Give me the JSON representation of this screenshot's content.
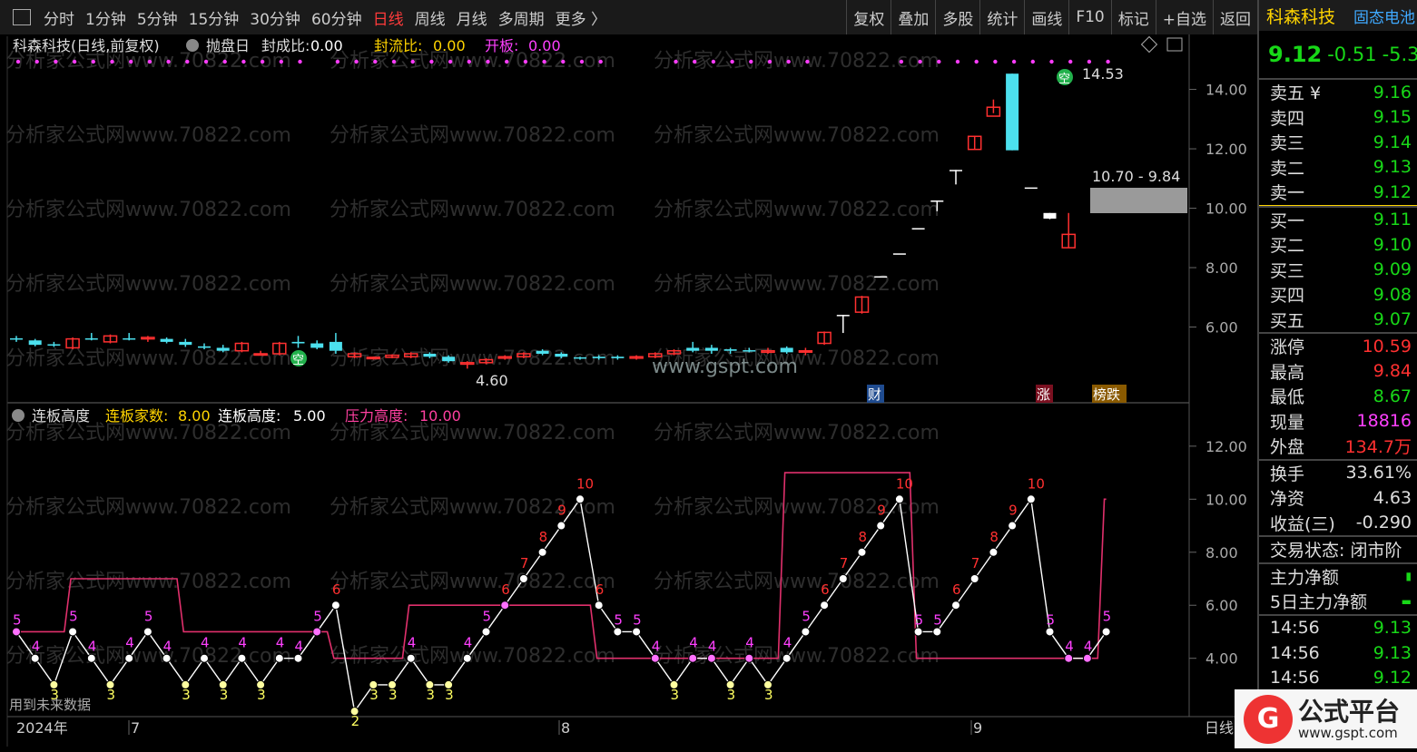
{
  "toolbar": {
    "periods": [
      "分时",
      "1分钟",
      "5分钟",
      "15分钟",
      "30分钟",
      "60分钟",
      "日线",
      "周线",
      "月线",
      "多周期",
      "更多 〉"
    ],
    "active": "日线",
    "actions": [
      "复权",
      "叠加",
      "多股",
      "统计",
      "画线",
      "F10",
      "标记",
      "+自选",
      "返回"
    ]
  },
  "chart_title": "科森科技(日线,前复权)",
  "main_labels": {
    "flag": "抛盘日",
    "fcb_label": "封成比:",
    "fcb_value": "0.00",
    "flb_label": "封流比:",
    "flb_value": "0.00",
    "kb_label": "开板:",
    "kb_value": "0.00"
  },
  "annotations": {
    "high": "14.53",
    "low": "4.60",
    "gap": "10.70 - 9.84",
    "kong": "空",
    "markers": [
      "财",
      "涨",
      "榜跌"
    ],
    "watermark": "www.gspt.com",
    "bg_watermark": "分析家公式网www.70822.com"
  },
  "price_axis": [
    "14.00",
    "12.00",
    "10.00",
    "8.00",
    "6.00"
  ],
  "sub_title": "连板高度",
  "sub_labels": {
    "lbjs_label": "连板家数:",
    "lbjs_value": "8.00",
    "lbgd_label": "连板高度:",
    "lbgd_value": "5.00",
    "ylgd_label": "压力高度:",
    "ylgd_value": "10.00"
  },
  "sub_axis": [
    "12.00",
    "10.00",
    "8.00",
    "6.00",
    "4.00"
  ],
  "future_note": "用到未来数据",
  "time_axis": [
    "2024年",
    "7",
    "8",
    "9"
  ],
  "period_label": "日线",
  "chart_data": {
    "type": "line",
    "candles": [
      [
        5.62,
        5.7,
        5.5,
        5.6,
        "c"
      ],
      [
        5.55,
        5.6,
        5.35,
        5.4,
        "c"
      ],
      [
        5.42,
        5.5,
        5.33,
        5.4,
        "c"
      ],
      [
        5.3,
        5.65,
        5.25,
        5.6,
        "r"
      ],
      [
        5.62,
        5.8,
        5.55,
        5.6,
        "c"
      ],
      [
        5.5,
        5.75,
        5.45,
        5.7,
        "r"
      ],
      [
        5.62,
        5.8,
        5.55,
        5.6,
        "c"
      ],
      [
        5.6,
        5.7,
        5.5,
        5.65,
        "r"
      ],
      [
        5.6,
        5.65,
        5.45,
        5.5,
        "c"
      ],
      [
        5.5,
        5.6,
        5.33,
        5.4,
        "c"
      ],
      [
        5.35,
        5.45,
        5.25,
        5.3,
        "c"
      ],
      [
        5.3,
        5.4,
        5.15,
        5.2,
        "c"
      ],
      [
        5.2,
        5.5,
        5.15,
        5.45,
        "r"
      ],
      [
        5.1,
        5.2,
        5.05,
        5.1,
        "r"
      ],
      [
        5.1,
        5.5,
        5.05,
        5.45,
        "r"
      ],
      [
        5.45,
        5.7,
        5.3,
        5.5,
        "c"
      ],
      [
        5.45,
        5.55,
        5.25,
        5.3,
        "c"
      ],
      [
        5.5,
        5.8,
        5.1,
        5.2,
        "c"
      ],
      [
        5.1,
        5.15,
        4.95,
        5.0,
        "r"
      ],
      [
        4.96,
        5.0,
        4.9,
        4.98,
        "r"
      ],
      [
        4.98,
        5.08,
        4.95,
        5.05,
        "r"
      ],
      [
        5.0,
        5.15,
        4.95,
        5.1,
        "r"
      ],
      [
        5.1,
        5.15,
        4.95,
        5.0,
        "c"
      ],
      [
        5.0,
        5.05,
        4.8,
        4.85,
        "c"
      ],
      [
        4.75,
        4.85,
        4.6,
        4.8,
        "r"
      ],
      [
        4.8,
        4.95,
        4.75,
        4.9,
        "r"
      ],
      [
        4.95,
        5.05,
        4.9,
        5.0,
        "r"
      ],
      [
        5.0,
        5.15,
        4.95,
        5.1,
        "r"
      ],
      [
        5.1,
        5.25,
        5.05,
        5.2,
        "c"
      ],
      [
        5.1,
        5.15,
        4.95,
        5.0,
        "c"
      ],
      [
        4.95,
        5.0,
        4.9,
        4.98,
        "c"
      ],
      [
        5.0,
        5.05,
        4.9,
        4.95,
        "c"
      ],
      [
        4.95,
        5.05,
        4.9,
        5.0,
        "c"
      ],
      [
        4.95,
        5.05,
        4.9,
        5.0,
        "r"
      ],
      [
        5.0,
        5.15,
        4.95,
        5.1,
        "r"
      ],
      [
        5.1,
        5.25,
        5.05,
        5.2,
        "r"
      ],
      [
        5.2,
        5.5,
        5.15,
        5.3,
        "c"
      ],
      [
        5.3,
        5.4,
        5.1,
        5.2,
        "c"
      ],
      [
        5.2,
        5.3,
        5.1,
        5.25,
        "c"
      ],
      [
        5.2,
        5.3,
        5.15,
        5.22,
        "c"
      ],
      [
        5.15,
        5.3,
        5.1,
        5.2,
        "r"
      ],
      [
        5.15,
        5.35,
        5.1,
        5.3,
        "c"
      ],
      [
        5.2,
        5.3,
        5.05,
        5.2,
        "r"
      ],
      [
        5.45,
        5.85,
        5.4,
        5.82,
        "r"
      ],
      [
        6.41,
        6.41,
        5.8,
        6.41,
        "w"
      ],
      [
        6.5,
        7.05,
        6.45,
        7.01,
        "r"
      ],
      [
        7.71,
        7.71,
        7.71,
        7.71,
        "w"
      ],
      [
        8.48,
        8.48,
        8.48,
        8.48,
        "w"
      ],
      [
        9.33,
        9.33,
        9.33,
        9.33,
        "w"
      ],
      [
        10.26,
        10.26,
        9.9,
        10.26,
        "w"
      ],
      [
        11.29,
        11.29,
        10.8,
        11.29,
        "w"
      ],
      [
        11.98,
        12.42,
        11.98,
        12.42,
        "r"
      ],
      [
        13.1,
        13.66,
        13.2,
        13.4,
        "r"
      ],
      [
        14.53,
        14.53,
        11.95,
        11.95,
        "c"
      ],
      [
        10.7,
        10.7,
        10.7,
        10.7,
        "w"
      ],
      [
        9.84,
        9.84,
        9.63,
        9.65,
        "w"
      ],
      [
        8.67,
        9.84,
        8.67,
        9.12,
        "r"
      ]
    ],
    "lbjs_series": [
      5,
      4,
      3,
      5,
      4,
      3,
      4,
      5,
      4,
      3,
      4,
      3,
      4,
      3,
      4,
      4,
      5,
      6,
      2,
      3,
      3,
      4,
      3,
      3,
      4,
      5,
      6,
      7,
      8,
      9,
      10,
      6,
      5,
      5,
      4,
      3,
      4,
      4,
      3,
      4,
      3,
      4,
      5,
      6,
      7,
      8,
      9,
      10,
      5,
      5,
      6,
      7,
      8,
      9,
      10,
      5,
      4,
      4,
      5
    ],
    "yl_series": [
      5,
      5,
      5,
      7,
      7,
      7,
      7,
      7,
      7,
      5,
      5,
      5,
      5,
      5,
      5,
      5,
      5,
      4,
      4,
      4,
      4,
      6,
      6,
      6,
      6,
      6,
      6,
      6,
      6,
      6,
      6,
      4,
      4,
      4,
      4,
      4,
      4,
      4,
      4,
      4,
      4,
      11,
      11,
      11,
      11,
      11,
      11,
      11,
      4,
      4,
      4,
      4,
      4,
      4,
      4,
      4,
      4,
      4,
      10
    ],
    "sub_ylim": [
      1.8,
      13.5
    ],
    "price_ylim": [
      4.0,
      15.3
    ]
  },
  "quote": {
    "name": "科森科技",
    "sector": "固态电池",
    "price": "9.12",
    "change": "-0.51",
    "pct": "-5.3",
    "sells": [
      {
        "label": "卖五 ¥",
        "value": "9.16"
      },
      {
        "label": "卖四",
        "value": "9.15"
      },
      {
        "label": "卖三",
        "value": "9.14"
      },
      {
        "label": "卖二",
        "value": "9.13"
      },
      {
        "label": "卖一",
        "value": "9.12"
      }
    ],
    "buys": [
      {
        "label": "买一",
        "value": "9.11"
      },
      {
        "label": "买二",
        "value": "9.10"
      },
      {
        "label": "买三",
        "value": "9.09"
      },
      {
        "label": "买四",
        "value": "9.08"
      },
      {
        "label": "买五",
        "value": "9.07"
      }
    ],
    "stats1": [
      {
        "label": "涨停",
        "value": "10.59",
        "cls": "red"
      },
      {
        "label": "最高",
        "value": "9.84",
        "cls": "red"
      },
      {
        "label": "最低",
        "value": "8.67",
        "cls": "grn"
      },
      {
        "label": "现量",
        "value": "18816",
        "cls": "mag"
      },
      {
        "label": "外盘",
        "value": "134.7万",
        "cls": "red"
      }
    ],
    "stats2": [
      {
        "label": "换手",
        "value": "33.61%"
      },
      {
        "label": "净资",
        "value": "4.63"
      },
      {
        "label": "收益(三)",
        "value": "-0.290"
      }
    ],
    "trade_state": "交易状态: 闭市阶",
    "main_net": "主力净额",
    "main_net5": "5日主力净额",
    "ticks": [
      {
        "time": "14:56",
        "price": "9.13"
      },
      {
        "time": "14:56",
        "price": "9.13"
      },
      {
        "time": "14:56",
        "price": "9.12"
      }
    ]
  },
  "footer_logo": {
    "mark": "G",
    "title": "公式平台",
    "url": "www.gspt.com"
  }
}
